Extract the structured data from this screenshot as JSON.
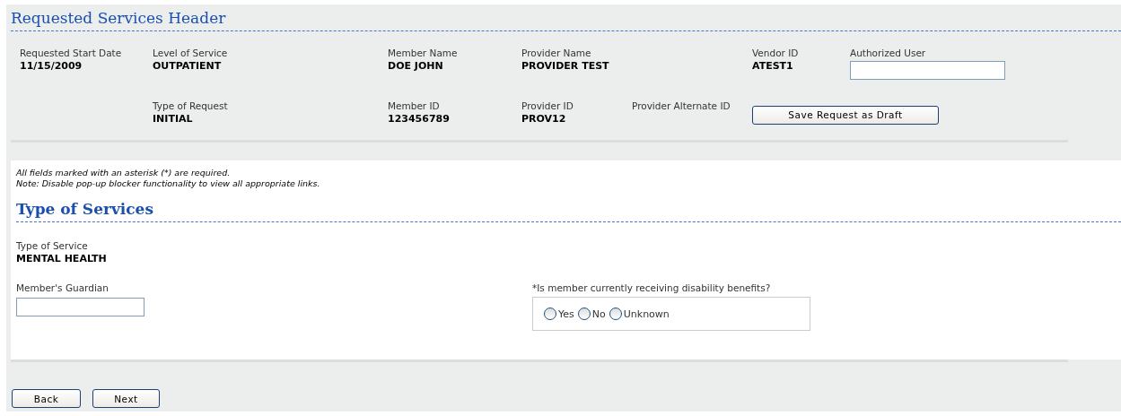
{
  "header": {
    "title": "Requested Services Header",
    "fields": [
      {
        "label": "Requested Start Date",
        "value": "11/15/2009",
        "kind": "text"
      },
      {
        "label": "Level of Service",
        "value": "OUTPATIENT",
        "kind": "text"
      },
      {
        "label": "Member Name",
        "value": "DOE JOHN",
        "kind": "text"
      },
      {
        "label": "Provider Name",
        "value": "PROVIDER TEST",
        "kind": "text"
      },
      {
        "label": "Vendor ID",
        "value": "ATEST1",
        "kind": "text"
      },
      {
        "label": "Authorized User",
        "kind": "input"
      },
      {
        "label": "Type of Request",
        "value": "INITIAL",
        "kind": "text"
      },
      {
        "label": "Member ID",
        "value": "123456789",
        "kind": "text"
      },
      {
        "label": "Provider ID",
        "value": "PROV12",
        "kind": "text"
      },
      {
        "label": "Provider Alternate ID",
        "kind": "text"
      }
    ],
    "save_button": "Save Request as Draft"
  },
  "notes": [
    "All fields marked with an asterisk (*) are required.",
    "Note: Disable pop-up blocker functionality to view all appropriate links."
  ],
  "services": {
    "title": "Type of Services",
    "type_label": "Type of Service",
    "type_value": "MENTAL HEALTH",
    "guardian_label": "Member's Guardian",
    "question": "*Is member currently receiving disability benefits?",
    "options": [
      {
        "label": "Yes",
        "selected": false
      },
      {
        "label": "No",
        "selected": false
      },
      {
        "label": "Unknown",
        "selected": false
      }
    ]
  },
  "buttons": [
    "Back",
    "Next"
  ]
}
